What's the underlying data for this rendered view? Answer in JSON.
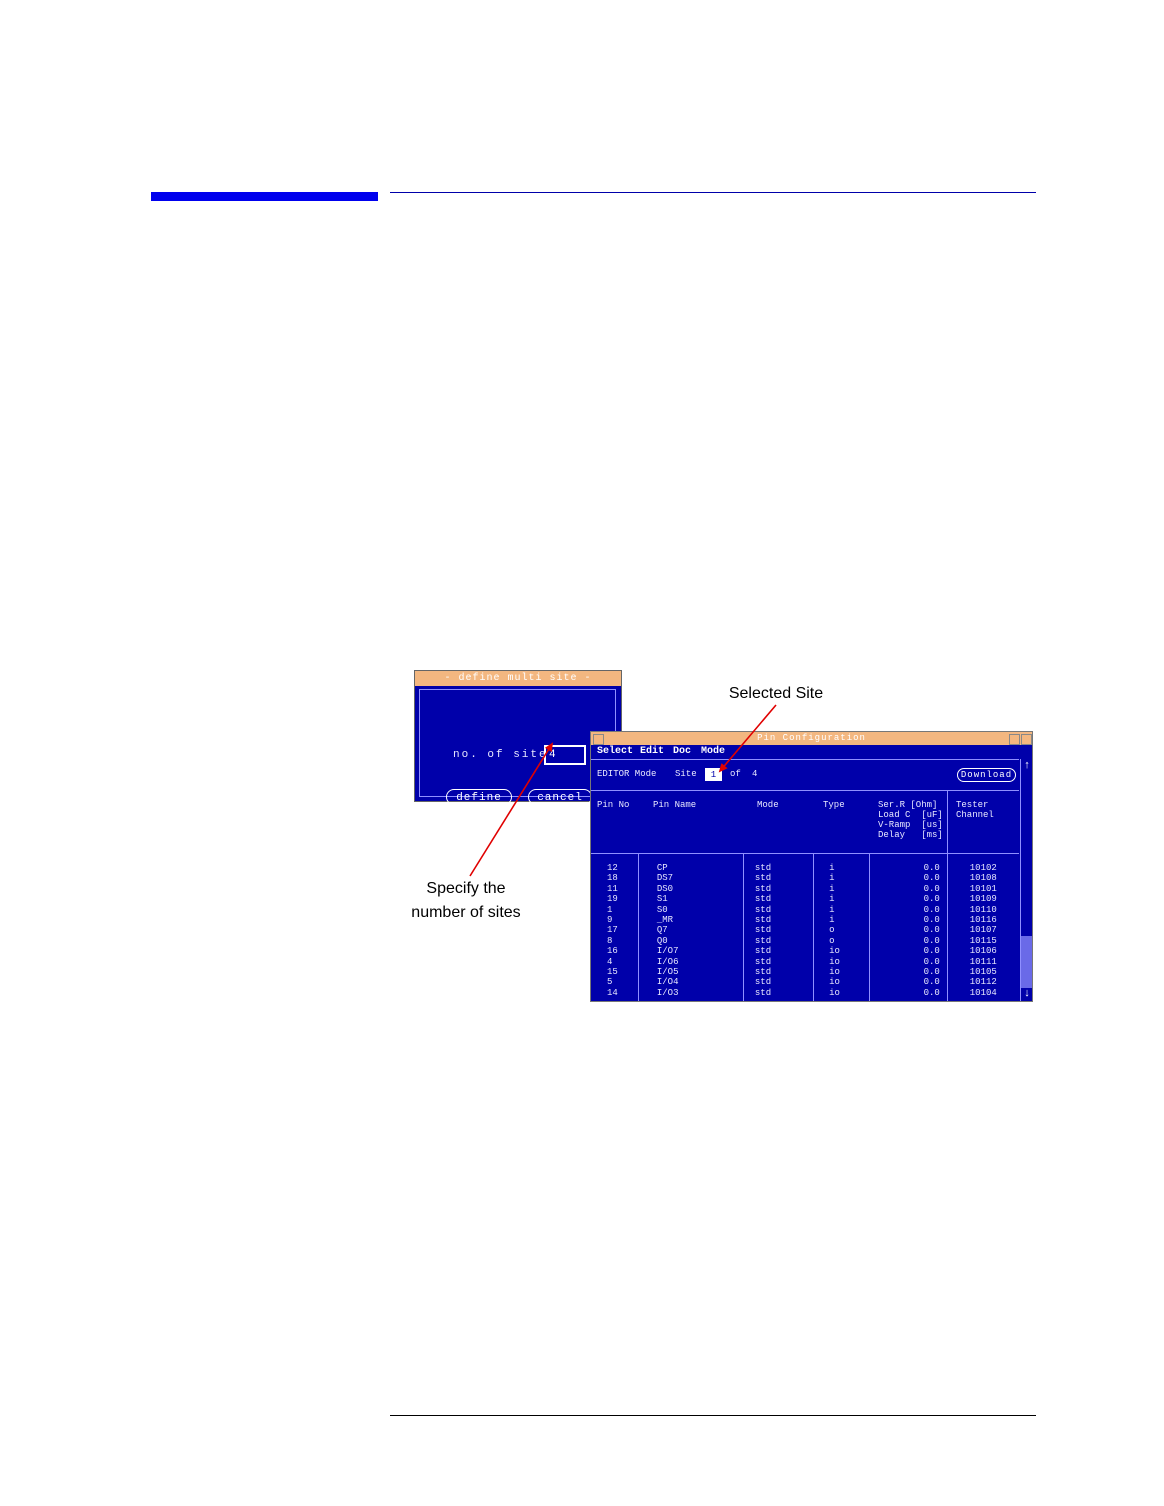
{
  "define_dialog": {
    "title": "- define multi site -",
    "label": "no. of sites",
    "value": "4",
    "define_label": "define",
    "cancel_label": "cancel"
  },
  "pin_dialog": {
    "title": "Pin Configuration",
    "menu": [
      "Select",
      "Edit",
      "Doc",
      "Mode"
    ],
    "editor_mode": "EDITOR Mode",
    "site_label": "Site",
    "site_value": "1",
    "of_label": "of",
    "of_value": "4",
    "download_label": "Download",
    "headers": {
      "pin_no": "Pin No",
      "pin_name": "Pin Name",
      "mode": "Mode",
      "type": "Type",
      "ser_r": "Ser.R [Ohm]",
      "load_c": "Load C  [uF]",
      "v_ramp": "V-Ramp  [us]",
      "delay": "Delay   [ms]",
      "tester": "Tester",
      "channel": "Channel"
    },
    "rows": [
      [
        "12",
        "CP",
        "std",
        "i",
        "0.0",
        "10102"
      ],
      [
        "18",
        "DS7",
        "std",
        "i",
        "0.0",
        "10108"
      ],
      [
        "11",
        "DS0",
        "std",
        "i",
        "0.0",
        "10101"
      ],
      [
        "19",
        "S1",
        "std",
        "i",
        "0.0",
        "10109"
      ],
      [
        "1",
        "S0",
        "std",
        "i",
        "0.0",
        "10110"
      ],
      [
        "9",
        "_MR",
        "std",
        "i",
        "0.0",
        "10116"
      ],
      [
        "17",
        "Q7",
        "std",
        "o",
        "0.0",
        "10107"
      ],
      [
        "8",
        "Q0",
        "std",
        "o",
        "0.0",
        "10115"
      ],
      [
        "16",
        "I/O7",
        "std",
        "io",
        "0.0",
        "10106"
      ],
      [
        "4",
        "I/O6",
        "std",
        "io",
        "0.0",
        "10111"
      ],
      [
        "15",
        "I/O5",
        "std",
        "io",
        "0.0",
        "10105"
      ],
      [
        "5",
        "I/O4",
        "std",
        "io",
        "0.0",
        "10112"
      ],
      [
        "14",
        "I/O3",
        "std",
        "io",
        "0.0",
        "10104"
      ]
    ]
  },
  "annotations": {
    "selected_site": "Selected Site",
    "specify_line1": "Specify the",
    "specify_line2": "number of sites"
  },
  "colors": {
    "window_bg": "#0000aa",
    "title_bar": "#f3b780",
    "header_bar": "#0000ee",
    "arrow": "#e00000"
  }
}
